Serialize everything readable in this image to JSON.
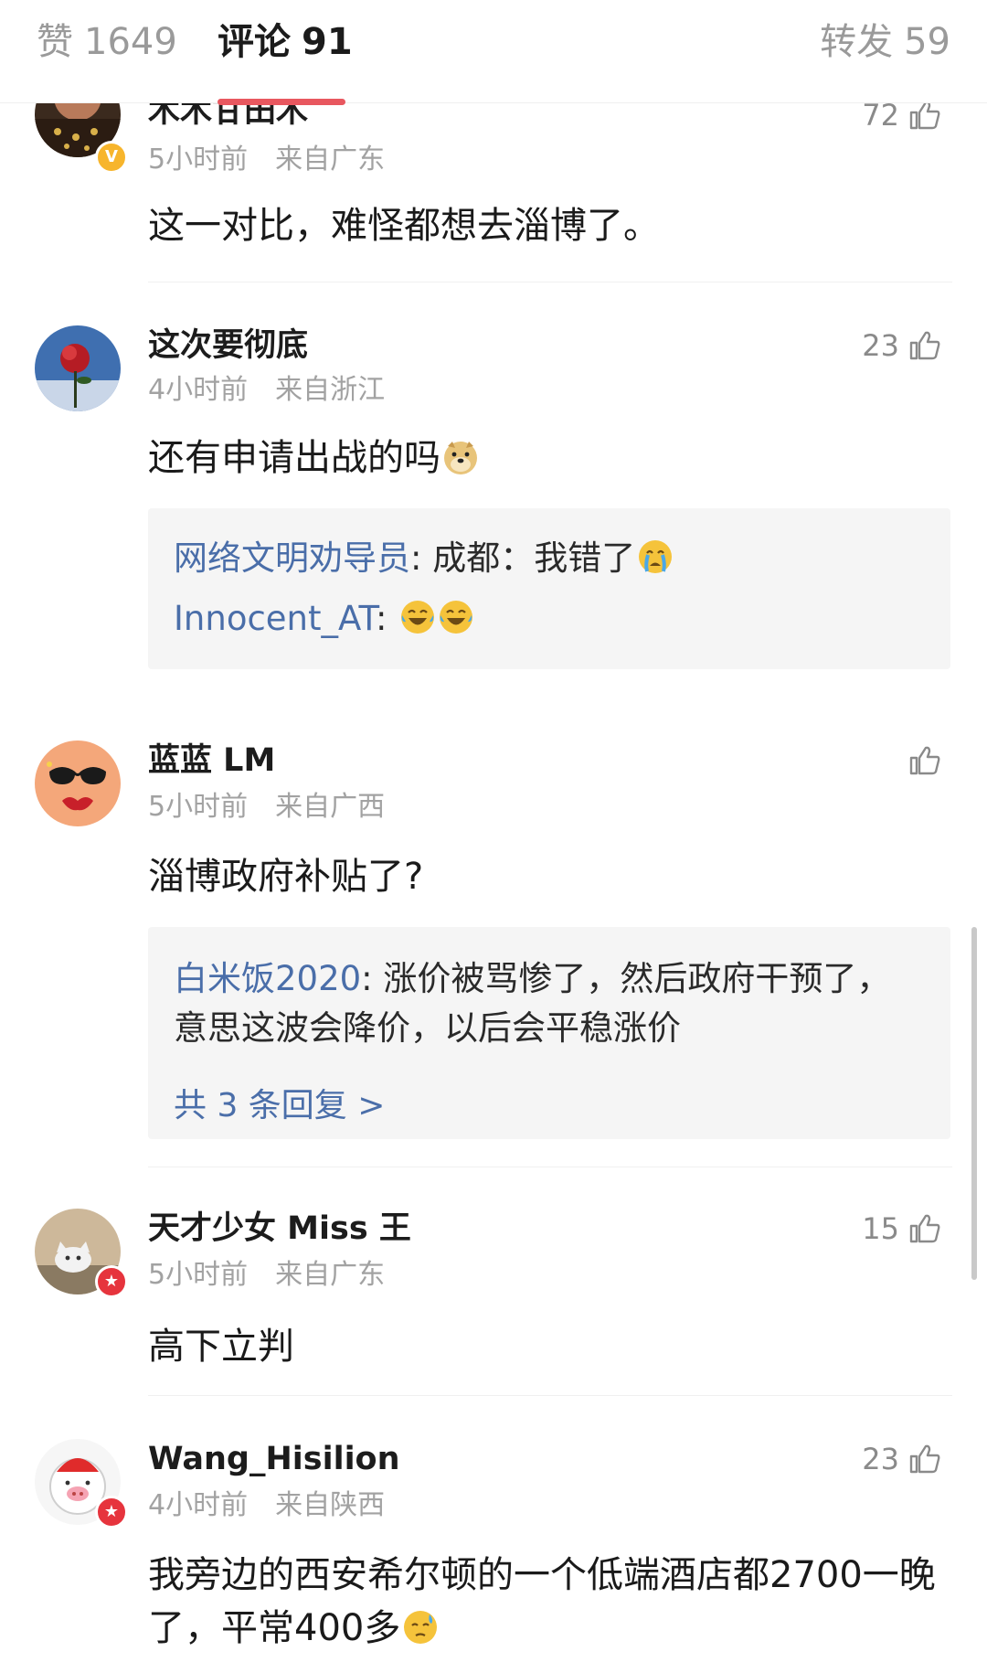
{
  "tabs": {
    "likes": {
      "label": "赞",
      "count": "1649"
    },
    "comments": {
      "label": "评论",
      "count": "91"
    },
    "reposts": {
      "label": "转发",
      "count": "59"
    }
  },
  "comments": [
    {
      "user": "木木甘田木",
      "time": "5小时前",
      "location": "来自广东",
      "likes": "72",
      "text": "这一对比，难怪都想去淄博了。",
      "badge": "V"
    },
    {
      "user": "这次要彻底",
      "time": "4小时前",
      "location": "来自浙江",
      "likes": "23",
      "text": "还有申请出战的吗",
      "replies": [
        {
          "user": "网络文明劝导员",
          "text": ": 成都：我错了"
        },
        {
          "user": "Innocent_AT",
          "text": ": "
        }
      ]
    },
    {
      "user": "蓝蓝 LM",
      "time": "5小时前",
      "location": "来自广西",
      "likes": "",
      "text": "淄博政府补贴了?",
      "replies": [
        {
          "user": "白米饭2020",
          "text": ": 涨价被骂惨了，然后政府干预了，意思这波会降价，以后会平稳涨价"
        }
      ],
      "more": "共 3 条回复 >"
    },
    {
      "user": "天才少女 Miss 王",
      "time": "5小时前",
      "location": "来自广东",
      "likes": "15",
      "text": "高下立判",
      "badge": "★"
    },
    {
      "user": "Wang_Hisilion",
      "time": "4小时前",
      "location": "来自陕西",
      "likes": "23",
      "text": "我旁边的西安希尔顿的一个低端酒店都2700一晚了，平常400多",
      "badge": "★"
    }
  ],
  "icons": {
    "like": "thumbs-up-icon",
    "emoji_dog": "doge-emoji-icon",
    "emoji_cry": "crying-emoji-icon",
    "emoji_laugh": "laughing-tears-emoji-icon",
    "emoji_sweat": "cold-sweat-emoji-icon"
  },
  "colors": {
    "accent": "#e8575f",
    "link": "#4a6ea9",
    "meta": "#a2a2a2"
  }
}
